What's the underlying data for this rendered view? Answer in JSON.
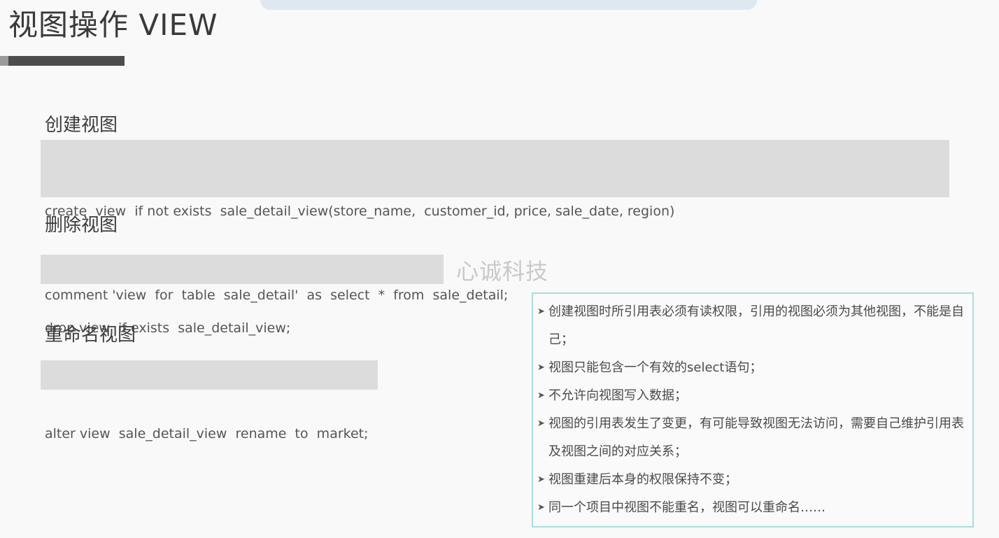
{
  "slide": {
    "title": "视图操作 VIEW"
  },
  "sections": [
    {
      "heading": "创建视图",
      "code": [
        "create  view  if not exists  sale_detail_view(store_name,  customer_id, price, sale_date, region)",
        "comment 'view  for  table  sale_detail'  as  select  *  from  sale_detail;"
      ]
    },
    {
      "heading": "删除视图",
      "code": [
        "drop view  if exists  sale_detail_view;"
      ]
    },
    {
      "heading": "重命名视图",
      "code": [
        "alter view  sale_detail_view  rename  to  market;"
      ]
    }
  ],
  "watermark": "心诚科技",
  "notes": [
    "创建视图时所引用表必须有读权限，引用的视图必须为其他视图，不能是自己；",
    "视图只能包含一个有效的select语句；",
    "不允许向视图写入数据；",
    "视图的引用表发生了变更，有可能导致视图无法访问，需要自己维护引用表及视图之间的对应关系；",
    "视图重建后本身的权限保持不变；",
    "同一个项目中视图不能重名，视图可以重命名……"
  ],
  "icons": {
    "bullet": "triangle-right-icon",
    "bullet_glyph": "➤"
  },
  "colors": {
    "code_background": "#dcdcdc",
    "notes_border": "#a9dede",
    "title_bar": "#4d4d4d"
  }
}
